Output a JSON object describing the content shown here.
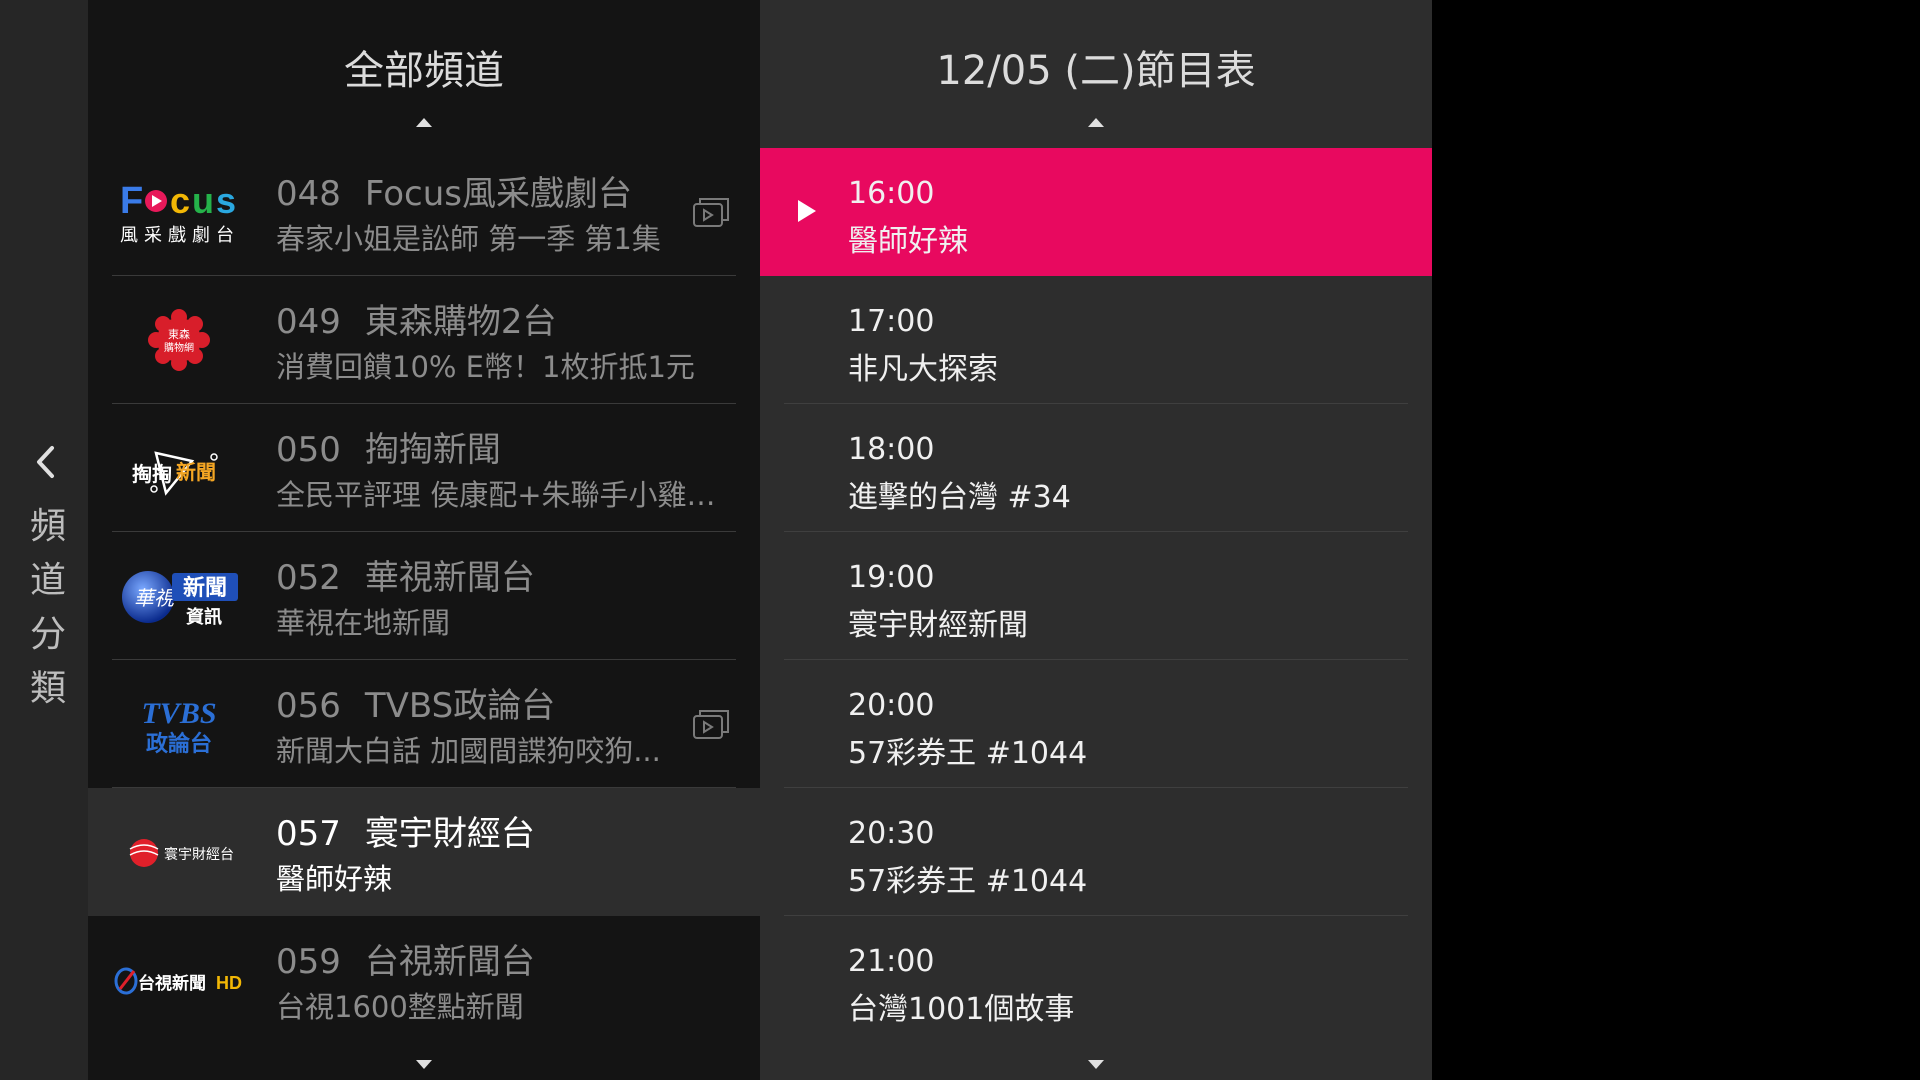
{
  "category": {
    "label_chars": [
      "頻",
      "道",
      "分",
      "類"
    ]
  },
  "channels_panel": {
    "title": "全部頻道",
    "items": [
      {
        "number": "048",
        "name": "Focus風采戲劇台",
        "program": "春家小姐是訟師 第一季 第1集",
        "logo": "Focus 風采戲劇台",
        "multi": true
      },
      {
        "number": "049",
        "name": "東森購物2台",
        "program": "消費回饋10% E幣！1枚折抵1元",
        "logo": "東森購物網",
        "multi": false
      },
      {
        "number": "050",
        "name": "掏掏新聞",
        "program": "全民平評理 侯康配+朱聯手小雞站...",
        "logo": "掏掏新聞",
        "multi": false
      },
      {
        "number": "052",
        "name": "華視新聞台",
        "program": "華視在地新聞",
        "logo": "華視新聞資訊",
        "multi": false
      },
      {
        "number": "056",
        "name": "TVBS政論台",
        "program": "新聞大白話 加國間諜狗咬狗...",
        "logo": "TVBS 政論台",
        "multi": true
      },
      {
        "number": "057",
        "name": "寰宇財經台",
        "program": "醫師好辣",
        "logo": "寰宇財經台",
        "multi": false
      },
      {
        "number": "059",
        "name": "台視新聞台",
        "program": "台視1600整點新聞",
        "logo": "台視新聞HD",
        "multi": false
      }
    ]
  },
  "programs_panel": {
    "title": "12/05 (二)節目表",
    "items": [
      {
        "time": "16:00",
        "name": "醫師好辣"
      },
      {
        "time": "17:00",
        "name": "非凡大探索"
      },
      {
        "time": "18:00",
        "name": "進擊的台灣 #34"
      },
      {
        "time": "19:00",
        "name": "寰宇財經新聞"
      },
      {
        "time": "20:00",
        "name": "57彩券王 #1044"
      },
      {
        "time": "20:30",
        "name": "57彩券王 #1044"
      },
      {
        "time": "21:00",
        "name": "台灣1001個故事"
      }
    ]
  },
  "colors": {
    "accent": "#e8095f",
    "panel_dark": "#141414",
    "panel_mid": "#2d2d2d"
  }
}
